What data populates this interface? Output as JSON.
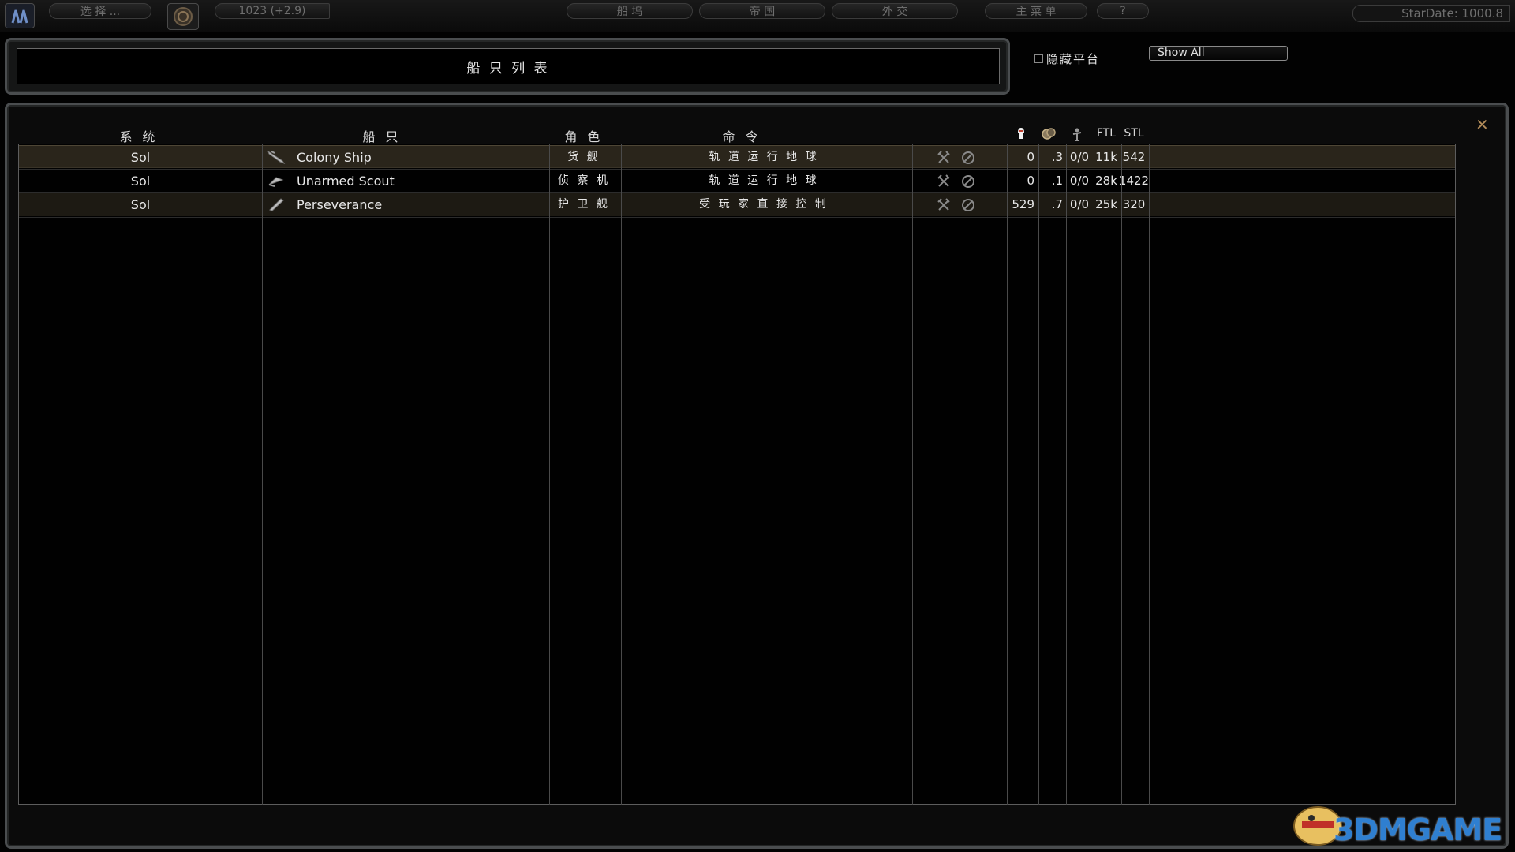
{
  "topbar": {
    "select_label": "选 择 ...",
    "credits": "1023 (+2.9)",
    "nav": [
      "船 坞",
      "帝 国",
      "外 交",
      "主 菜 单",
      "?"
    ],
    "stardate": "StarDate: 1000.8"
  },
  "panel": {
    "title": "船 只 列 表",
    "hide_platforms_label": "隐藏平台",
    "filter_value": "Show All"
  },
  "table": {
    "headers": {
      "system": "系 统",
      "ship": "船 只",
      "role": "角 色",
      "order": "命 令",
      "ftl": "FTL",
      "stl": "STL"
    },
    "rows": [
      {
        "system": "Sol",
        "ship": "Colony Ship",
        "role": "货 舰",
        "order": "轨 道 运 行 地 球",
        "c1": "0",
        "c2": ".3",
        "c3": "0/0",
        "ftl": "11k",
        "stl": "542"
      },
      {
        "system": "Sol",
        "ship": "Unarmed Scout",
        "role": "侦 察 机",
        "order": "轨 道 运 行 地 球",
        "c1": "0",
        "c2": ".1",
        "c3": "0/0",
        "ftl": "28k",
        "stl": "1422"
      },
      {
        "system": "Sol",
        "ship": "Perseverance",
        "role": "护 卫 舰",
        "order": "受 玩 家 直 接 控 制",
        "c1": "529",
        "c2": ".7",
        "c3": "0/0",
        "ftl": "25k",
        "stl": "320"
      }
    ]
  },
  "watermark": "3DMGAME",
  "colors": {
    "accent": "#b08a58",
    "row_selected": "#2a251b",
    "border": "#4a4d4f"
  }
}
